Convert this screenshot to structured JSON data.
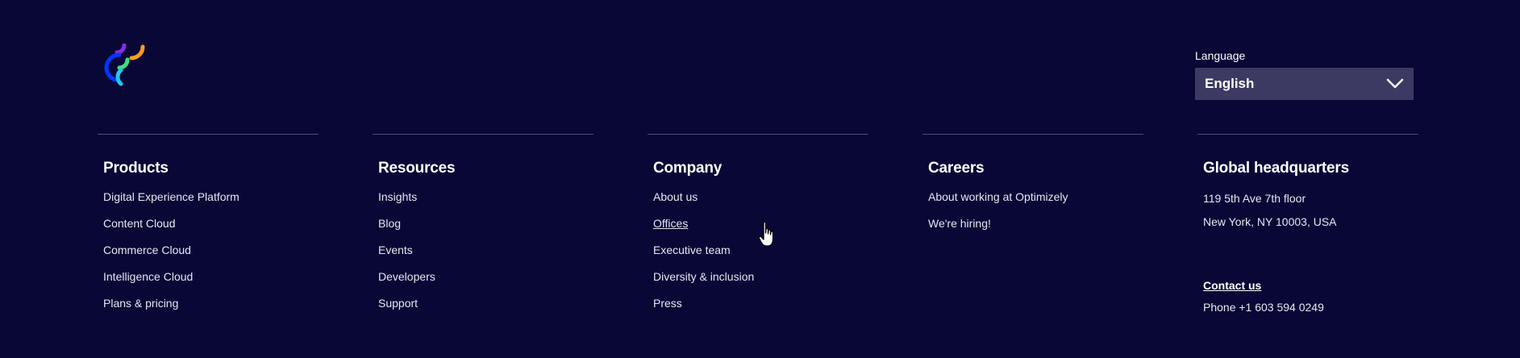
{
  "logo": {
    "icon": "optimizely-logo-icon"
  },
  "language": {
    "label": "Language",
    "selected": "English",
    "icon": "chevron-down-icon"
  },
  "columns": [
    {
      "title": "Products",
      "links": [
        "Digital Experience Platform",
        "Content Cloud",
        "Commerce Cloud",
        "Intelligence Cloud",
        "Plans & pricing"
      ]
    },
    {
      "title": "Resources",
      "links": [
        "Insights",
        "Blog",
        "Events",
        "Developers",
        "Support"
      ]
    },
    {
      "title": "Company",
      "links": [
        "About us",
        "Offices",
        "Executive team",
        "Diversity & inclusion",
        "Press"
      ]
    },
    {
      "title": "Careers",
      "links": [
        "About working at Optimizely",
        "We're hiring!"
      ]
    }
  ],
  "hq": {
    "title": "Global headquarters",
    "address_line1": "119 5th Ave 7th floor",
    "address_line2": "New York, NY 10003, USA",
    "contact": "Contact us",
    "phone": "Phone +1 603 594 0249"
  },
  "colors": {
    "background": "#080736",
    "select_bg": "#3c3a63",
    "divider": "#4c4b72",
    "logo_orange": "#f79c22",
    "logo_purple": "#8b2be2",
    "logo_green": "#3be081",
    "logo_blue": "#0037ff",
    "logo_cyan": "#23c6f0"
  },
  "cursor": {
    "icon": "hand-pointer-cursor-icon"
  }
}
